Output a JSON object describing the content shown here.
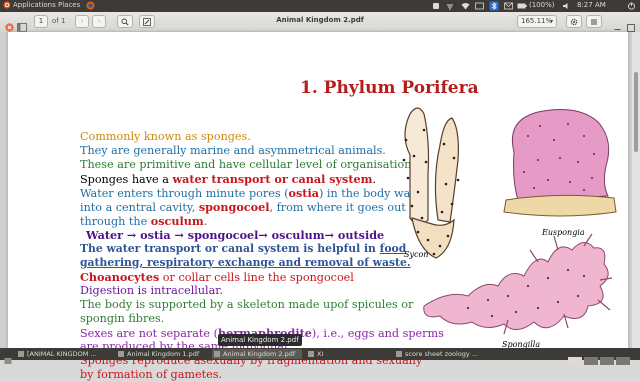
{
  "system_bar": {
    "menu_applications": "Applications",
    "menu_places": "Places",
    "battery": "(100%)",
    "time": "8:27 AM"
  },
  "header": {
    "page_number": "1",
    "page_of": "of 1",
    "window_title": "Animal Kingdom 2.pdf",
    "zoom": "165.11%"
  },
  "document": {
    "heading": "1. Phylum Porifera",
    "lines": [
      {
        "text": "Commonly known as sponges.",
        "color": "#d08a0a"
      },
      {
        "text": "They are generally marine and asymmetrical animals.",
        "color": "#1f6fa6"
      },
      {
        "text": "These are primitive and have cellular level of organisation.",
        "color": "#2e7d32"
      },
      {
        "prefix": "Sponges have a ",
        "highlight": "water transport or canal system",
        "suffix": ".",
        "color": "#000000",
        "hl_color": "#c8151b"
      },
      {
        "prefix": "Water enters through minute pores (",
        "highlight": "ostia",
        "suffix": ") in the body wall",
        "color": "#1f6fa6",
        "hl_color": "#c8151b"
      },
      {
        "prefix": "into a central cavity,  ",
        "highlight": "spongocoel",
        "suffix": ", from where it goes out",
        "color": "#1f6fa6",
        "hl_color": "#c8151b"
      },
      {
        "prefix": "through the ",
        "highlight": "osculum",
        "suffix": ".",
        "color": "#1f6fa6",
        "hl_color": "#c8151b"
      },
      {
        "text": "Water → ostia → spongocoel→ osculum→ outside",
        "color": "#4a148c"
      },
      {
        "text": "The water transport or canal system is helpful in food",
        "color": "#2f5597"
      },
      {
        "text": "gathering, respiratory exchange and removal of waste.",
        "color": "#2f5597"
      },
      {
        "highlight": "Choanocytes",
        "suffix": " or collar cells line the spongocoel",
        "color": "#c8151b",
        "hl_color": "#c8151b"
      },
      {
        "text": "Digestion is intracellular.",
        "color": "#6a1b9a"
      },
      {
        "text": "The body is supported by a skeleton made upof spicules or",
        "color": "#2e7d32"
      },
      {
        "text": "spongin fibres.",
        "color": "#2e7d32"
      },
      {
        "prefix": "Sexes are not separate (",
        "highlight": "hermaphrodite",
        "suffix": "), i.e., eggs and sperms",
        "color": "#8e24aa",
        "hl_color": "#8e24aa"
      },
      {
        "text": "are produced by the same individual.",
        "color": "#8e24aa"
      },
      {
        "text": "Sponges reproduce asexually by fragmentation and sexually",
        "color": "#c8151b"
      },
      {
        "text": "by formation of gametes.",
        "color": "#c8151b"
      }
    ],
    "figure_labels": {
      "sycon": "Sycon",
      "euspongia": "Euspongia",
      "spongilla": "Spongilla"
    }
  },
  "taskbar": {
    "items": [
      "[ANIMAL KINGDOM ...",
      "Animal Kingdom 1.pdf",
      "Animal Kingdom 2.pdf",
      "XI",
      "score sheet zoology ..."
    ],
    "tooltip": "Animal Kingdom 2.pdf"
  },
  "colors": {
    "heading": "#b71c1c",
    "panel": "#3c3b37"
  }
}
